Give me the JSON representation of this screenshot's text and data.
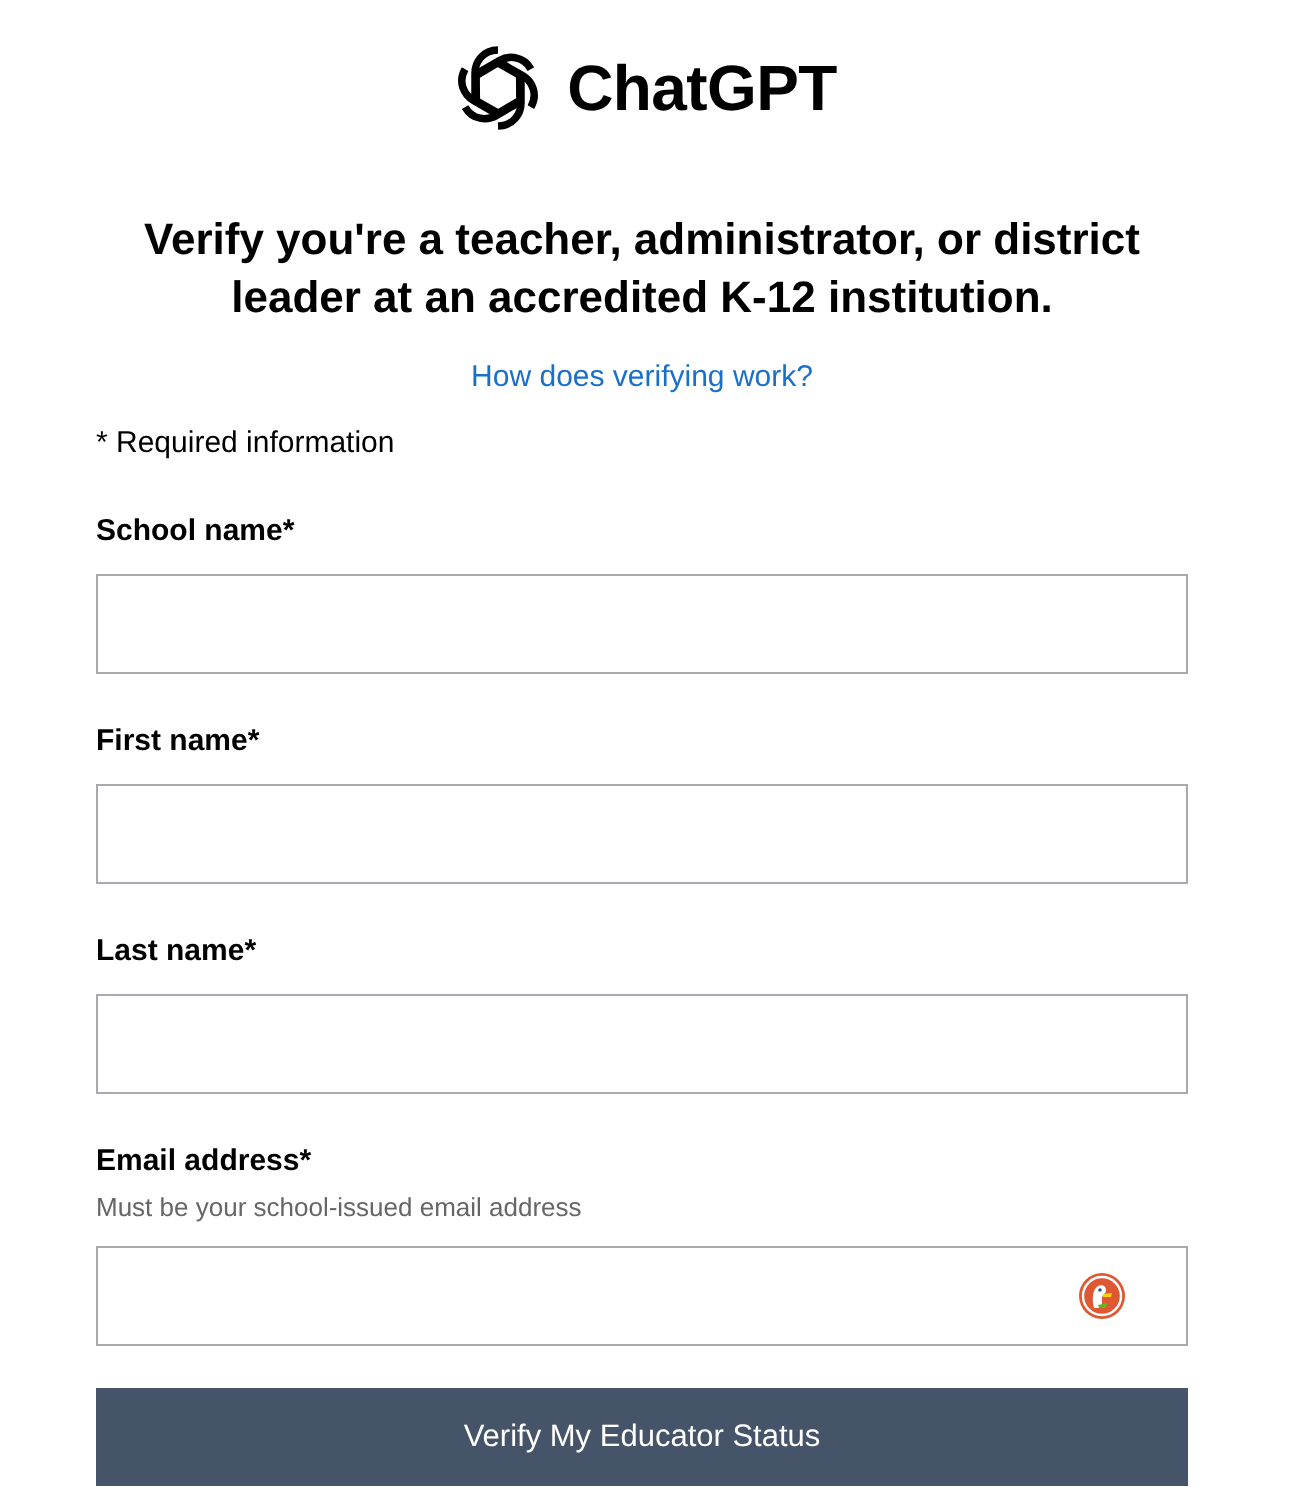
{
  "logo": {
    "name": "ChatGPT"
  },
  "heading": "Verify you're a teacher, administrator, or district leader at an accredited K-12 institution.",
  "help_link": "How does verifying work?",
  "required_note": "* Required information",
  "fields": [
    {
      "label": "School name*",
      "kind": "text"
    },
    {
      "label": "First name*",
      "kind": "text"
    },
    {
      "label": "Last name*",
      "kind": "text"
    },
    {
      "label": "Email address*",
      "hint": "Must be your school-issued email address",
      "kind": "email"
    }
  ],
  "submit_button": "Verify My Educator Status"
}
